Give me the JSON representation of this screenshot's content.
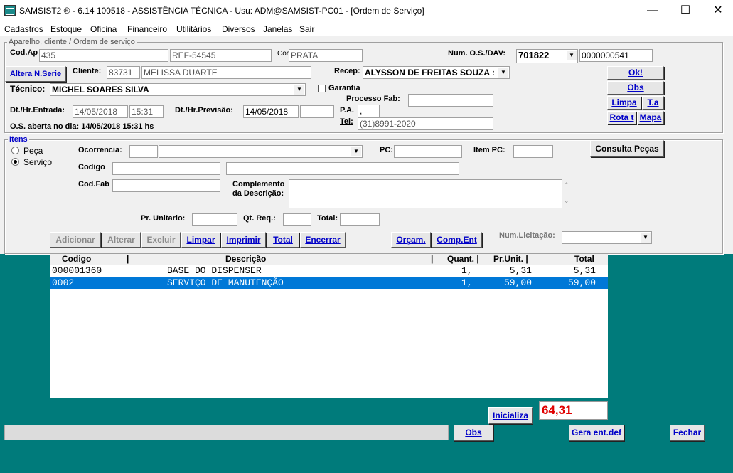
{
  "window": {
    "title": "SAMSIST2 ® - 6.14  100518 - ASSISTÊNCIA TÉCNICA - Usu: ADM@SAMSIST-PC01 - [Ordem de Serviço]",
    "minimize": "—",
    "maximize": "☐",
    "close": "✕"
  },
  "menu": [
    "Cadastros",
    "Estoque",
    "Oficina",
    "Financeiro",
    "Utilitários",
    "Diversos",
    "Janelas",
    "Sair"
  ],
  "header": {
    "group_title": "Aparelho, cliente / Ordem de serviço",
    "cod_ap_label": "Cod.Ap",
    "cod_ap": "435",
    "ref": "REF-54545",
    "cor_label": "Cor",
    "cor": "PRATA",
    "num_os_label": "Num. O.S./DAV:",
    "num_os": "701822",
    "dav": "0000000541",
    "altera_label": "Altera N.Serie",
    "cliente_label": "Cliente:",
    "cliente_cod": "83731",
    "cliente_nome": "MELISSA DUARTE",
    "recep_label": "Recep:",
    "recep": "ALYSSON DE FREITAS SOUZA :",
    "tecnico_label": "Técnico:",
    "tecnico": "MICHEL SOARES SILVA",
    "garantia_label": "Garantia",
    "processo_label": "Processo Fab:",
    "processo": "",
    "entrada_label": "Dt./Hr.Entrada:",
    "entrada_data": "14/05/2018",
    "entrada_hora": "15:31",
    "previsao_label": "Dt./Hr.Previsão:",
    "previsao_data": "14/05/2018",
    "previsao_hora": "",
    "pa_label": "P.A.",
    "pa": ",",
    "tel_label": "Tel:",
    "tel": "(31)8991-2020",
    "aberta_label": "O.S. aberta no dia: 14/05/2018  15:31 hs",
    "btn_ok": "Ok!",
    "btn_obs": "Obs",
    "btn_limpa": "Limpa",
    "btn_ta": "T.a",
    "btn_rota": "Rota t",
    "btn_mapa": "Mapa"
  },
  "itens": {
    "group_title": "Itens",
    "peca_label": "Peça",
    "servico_label": "Serviço",
    "ocorrencia_label": "Ocorrencia:",
    "pc_label": "PC:",
    "item_pc_label": "Item PC:",
    "consulta_label": "Consulta Peças",
    "codigo_label": "Codigo",
    "codfab_label": "Cod.Fab",
    "complemento_label1": "Complemento",
    "complemento_label2": "da Descrição:",
    "pr_unit_label": "Pr. Unitario:",
    "qt_req_label": "Qt. Req.:",
    "total_label": "Total:",
    "btn_adicionar": "Adicionar",
    "btn_alterar": "Alterar",
    "btn_excluir": "Excluir",
    "btn_limpar": "Limpar",
    "btn_imprimir": "Imprimir",
    "btn_total": "Total",
    "btn_encerrar": "Encerrar",
    "btn_orcam": "Orçam.",
    "btn_compent": "Comp.Ent",
    "num_licitacao_label": "Num.Licitação:"
  },
  "grid": {
    "headers": {
      "codigo": "Codigo",
      "sep1": "|",
      "descricao": "Descrição",
      "sep2": "|",
      "quant": "Quant. |",
      "prunit": "Pr.Unit.  |",
      "total": "Total"
    },
    "rows": [
      {
        "codigo": "000001360",
        "descricao": "BASE DO DISPENSER",
        "quant": "1,",
        "prunit": "5,31",
        "total": "5,31"
      },
      {
        "codigo": "0002",
        "descricao": "SERVIÇO DE MANUTENÇÃO",
        "quant": "1,",
        "prunit": "59,00",
        "total": "59,00"
      }
    ]
  },
  "footer": {
    "btn_inicializa": "Inicializa",
    "total_value": "64,31",
    "btn_obs": "Obs",
    "btn_gera": "Gera ent.def",
    "btn_fechar": "Fechar"
  }
}
